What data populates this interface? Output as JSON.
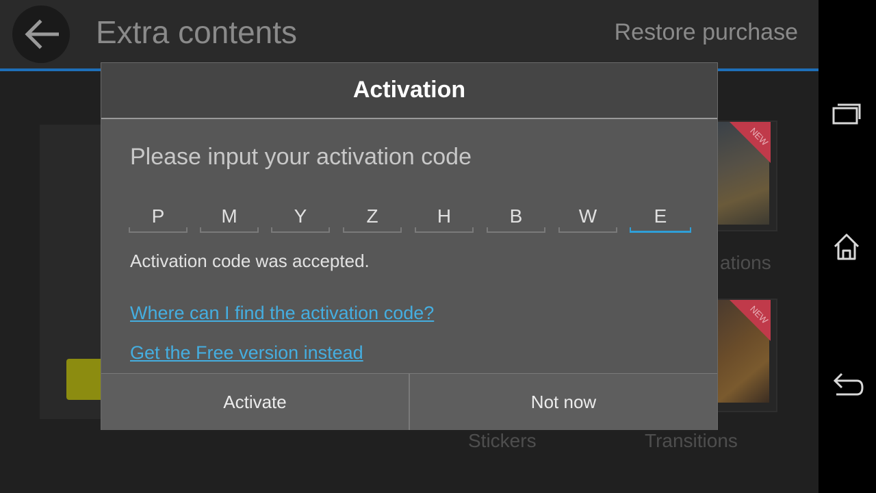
{
  "header": {
    "title": "Extra contents",
    "restore_label": "Restore purchase"
  },
  "background": {
    "thumb_badge": "NEW",
    "category_partial_label": "ations",
    "categories": [
      "Stickers",
      "Transitions"
    ]
  },
  "dialog": {
    "title": "Activation",
    "prompt": "Please input your activation code",
    "code": [
      "P",
      "M",
      "Y",
      "Z",
      "H",
      "B",
      "W",
      "E"
    ],
    "status": "Activation code was accepted.",
    "link_find_code": "Where can I find the activation code?",
    "link_free_version": "Get the Free version instead",
    "activate_label": "Activate",
    "not_now_label": "Not now"
  },
  "colors": {
    "accent": "#1e6fb8",
    "link": "#45aee0",
    "active_cell": "#2f9fd8",
    "badge": "#c03a4a"
  },
  "icons": {
    "back": "arrow-left-icon",
    "recent_apps": "recent-apps-icon",
    "home": "home-icon",
    "nav_back": "nav-back-icon"
  }
}
